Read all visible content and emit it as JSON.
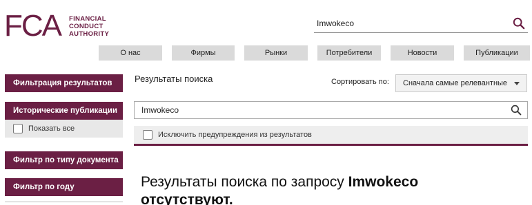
{
  "logo": {
    "mark": "FCA",
    "lines": [
      "FINANCIAL",
      "CONDUCT",
      "AUTHORITY"
    ],
    "color": "#6b1f44"
  },
  "top_search": {
    "value": "Imwokeco",
    "icon": "search-icon"
  },
  "nav": {
    "items": [
      "О нас",
      "Фирмы",
      "Рынки",
      "Потребители",
      "Новости",
      "Публикации"
    ]
  },
  "sidebar": {
    "filter_header": "Фильтрация результатов",
    "historical_header": "Исторические публикации",
    "show_all_label": "Показать все",
    "doc_type_header": "Фильтр по типу документа",
    "year_header": "Фильтр по году"
  },
  "main": {
    "results_title": "Результаты поиска",
    "sort_label": "Сортировать по:",
    "sort_value": "Сначала самые релевантные",
    "search_value": "Imwokeco",
    "exclude_label": "Исключить предупреждения из результатов",
    "no_results_prefix": "Результаты поиска по запросу ",
    "no_results_query": "Imwokeco",
    "no_results_suffix": "отсутствуют."
  },
  "colors": {
    "brand": "#6b1f44",
    "nav_bg": "#dadada"
  }
}
